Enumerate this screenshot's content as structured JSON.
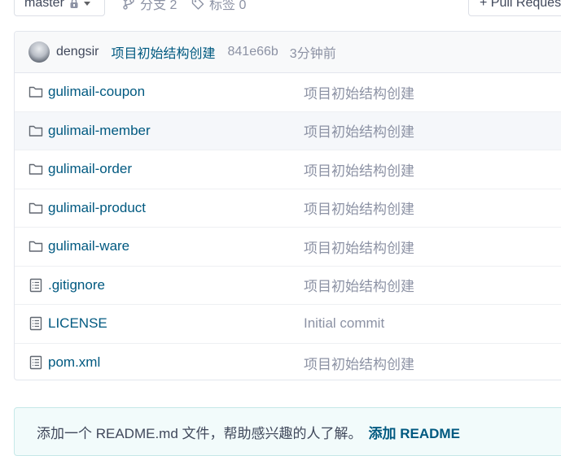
{
  "toolbar": {
    "branch": "master",
    "branches_label": "分支 2",
    "tags_label": "标签 0",
    "pull_request_label": "+ Pull Request"
  },
  "commit": {
    "author": "dengsir",
    "message": "项目初始结构创建",
    "sha": "841e66b",
    "time": "3分钟前"
  },
  "files": [
    {
      "name": "gulimail-coupon",
      "type": "folder",
      "commit": "项目初始结构创建"
    },
    {
      "name": "gulimail-member",
      "type": "folder",
      "commit": "项目初始结构创建"
    },
    {
      "name": "gulimail-order",
      "type": "folder",
      "commit": "项目初始结构创建"
    },
    {
      "name": "gulimail-product",
      "type": "folder",
      "commit": "项目初始结构创建"
    },
    {
      "name": "gulimail-ware",
      "type": "folder",
      "commit": "项目初始结构创建"
    },
    {
      "name": ".gitignore",
      "type": "file",
      "commit": "项目初始结构创建"
    },
    {
      "name": "LICENSE",
      "type": "file",
      "commit": "Initial commit"
    },
    {
      "name": "pom.xml",
      "type": "file",
      "commit": "项目初始结构创建"
    }
  ],
  "readme_hint": {
    "text": "添加一个 README.md 文件，帮助感兴趣的人了解。",
    "link": "添加 README"
  },
  "colors": {
    "link": "#005980",
    "muted": "#8c92a4",
    "text": "#40485b",
    "hint_bg": "#f2fbfb"
  }
}
